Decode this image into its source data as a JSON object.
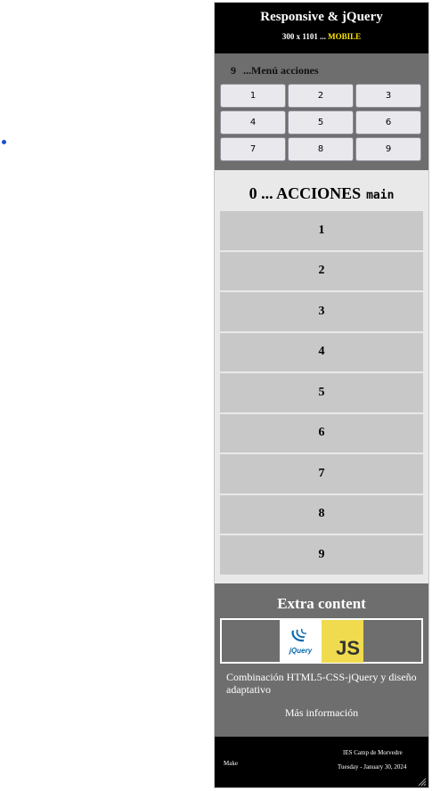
{
  "header": {
    "title": "Responsive & jQuery",
    "size": "300 x 1101",
    "dots": " ... ",
    "mode": "MOBILE"
  },
  "menu": {
    "count": "9",
    "title": "...Menú acciones",
    "buttons": [
      "1",
      "2",
      "3",
      "4",
      "5",
      "6",
      "7",
      "8",
      "9"
    ]
  },
  "acciones": {
    "count": "0",
    "title": "... ACCIONES",
    "tag": "main",
    "items": [
      "1",
      "2",
      "3",
      "4",
      "5",
      "6",
      "7",
      "8",
      "9"
    ]
  },
  "extra": {
    "title": "Extra content",
    "logo_left": "jQuery",
    "logo_right": "JS",
    "description": "Combinación HTML5-CSS-jQuery y diseño adaptativo",
    "more": "Más información"
  },
  "footer": {
    "make": "Make",
    "institution": "IES Camp de Morvedre",
    "date": "Tuesday - January 30, 2024"
  },
  "colors": {
    "accent": "#ffe600",
    "panel": "#6e6e6e",
    "bar": "#000000",
    "item": "#c8c8c8"
  }
}
